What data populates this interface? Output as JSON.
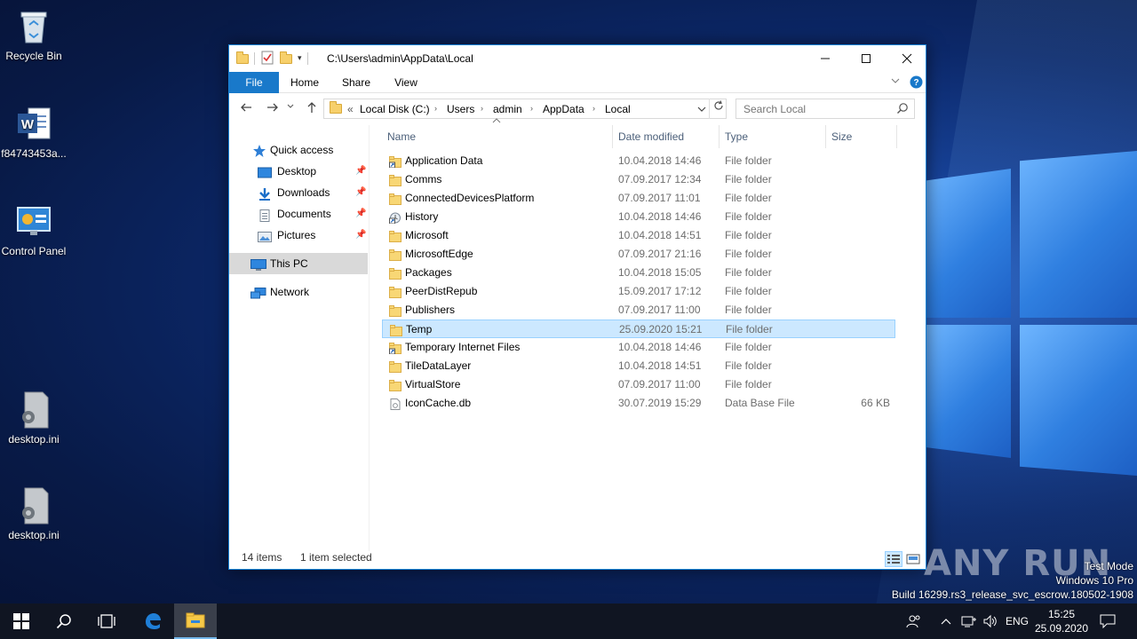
{
  "desktop": {
    "icons": [
      {
        "label": "Recycle Bin"
      },
      {
        "label": "f84743453a..."
      },
      {
        "label": "Control Panel"
      },
      {
        "label": "desktop.ini"
      },
      {
        "label": "desktop.ini"
      }
    ]
  },
  "window": {
    "title_path": "C:\\Users\\admin\\AppData\\Local",
    "ribbon_tabs": [
      "File",
      "Home",
      "Share",
      "View"
    ],
    "address": {
      "overflow": "«",
      "crumbs": [
        "Local Disk (C:)",
        "Users",
        "admin",
        "AppData",
        "Local"
      ]
    },
    "search": {
      "placeholder": "Search Local"
    },
    "nav": {
      "quick_access": "Quick access",
      "pinned": [
        "Desktop",
        "Downloads",
        "Documents",
        "Pictures"
      ],
      "this_pc": "This PC",
      "network": "Network"
    },
    "columns": {
      "name": "Name",
      "date": "Date modified",
      "type": "Type",
      "size": "Size"
    },
    "files": [
      {
        "name": "Application Data",
        "date": "10.04.2018 14:46",
        "type": "File folder",
        "size": "",
        "icon": "folder-shortcut-icon"
      },
      {
        "name": "Comms",
        "date": "07.09.2017 12:34",
        "type": "File folder",
        "size": "",
        "icon": "folder-icon"
      },
      {
        "name": "ConnectedDevicesPlatform",
        "date": "07.09.2017 11:01",
        "type": "File folder",
        "size": "",
        "icon": "folder-icon"
      },
      {
        "name": "History",
        "date": "10.04.2018 14:46",
        "type": "File folder",
        "size": "",
        "icon": "history-shortcut-icon"
      },
      {
        "name": "Microsoft",
        "date": "10.04.2018 14:51",
        "type": "File folder",
        "size": "",
        "icon": "folder-icon"
      },
      {
        "name": "MicrosoftEdge",
        "date": "07.09.2017 21:16",
        "type": "File folder",
        "size": "",
        "icon": "folder-icon"
      },
      {
        "name": "Packages",
        "date": "10.04.2018 15:05",
        "type": "File folder",
        "size": "",
        "icon": "folder-icon"
      },
      {
        "name": "PeerDistRepub",
        "date": "15.09.2017 17:12",
        "type": "File folder",
        "size": "",
        "icon": "folder-icon"
      },
      {
        "name": "Publishers",
        "date": "07.09.2017 11:00",
        "type": "File folder",
        "size": "",
        "icon": "folder-icon"
      },
      {
        "name": "Temp",
        "date": "25.09.2020 15:21",
        "type": "File folder",
        "size": "",
        "icon": "folder-icon",
        "selected": true
      },
      {
        "name": "Temporary Internet Files",
        "date": "10.04.2018 14:46",
        "type": "File folder",
        "size": "",
        "icon": "folder-shortcut-icon"
      },
      {
        "name": "TileDataLayer",
        "date": "10.04.2018 14:51",
        "type": "File folder",
        "size": "",
        "icon": "folder-icon"
      },
      {
        "name": "VirtualStore",
        "date": "07.09.2017 11:00",
        "type": "File folder",
        "size": "",
        "icon": "folder-icon"
      },
      {
        "name": "IconCache.db",
        "date": "30.07.2019 15:29",
        "type": "Data Base File",
        "size": "66 KB",
        "icon": "db-file-icon"
      }
    ],
    "status": {
      "items": "14 items",
      "selected": "1 item selected"
    }
  },
  "watermark": {
    "text": "ANY RUN"
  },
  "os_info": {
    "line1": "Test Mode",
    "line2": "Windows 10 Pro",
    "line3": "Build 16299.rs3_release_svc_escrow.180502-1908"
  },
  "taskbar": {
    "language": "ENG",
    "time": "15:25",
    "date": "25.09.2020"
  },
  "colors": {
    "accent": "#1979ca",
    "selection": "#cce8ff",
    "taskbar": "#101522"
  }
}
